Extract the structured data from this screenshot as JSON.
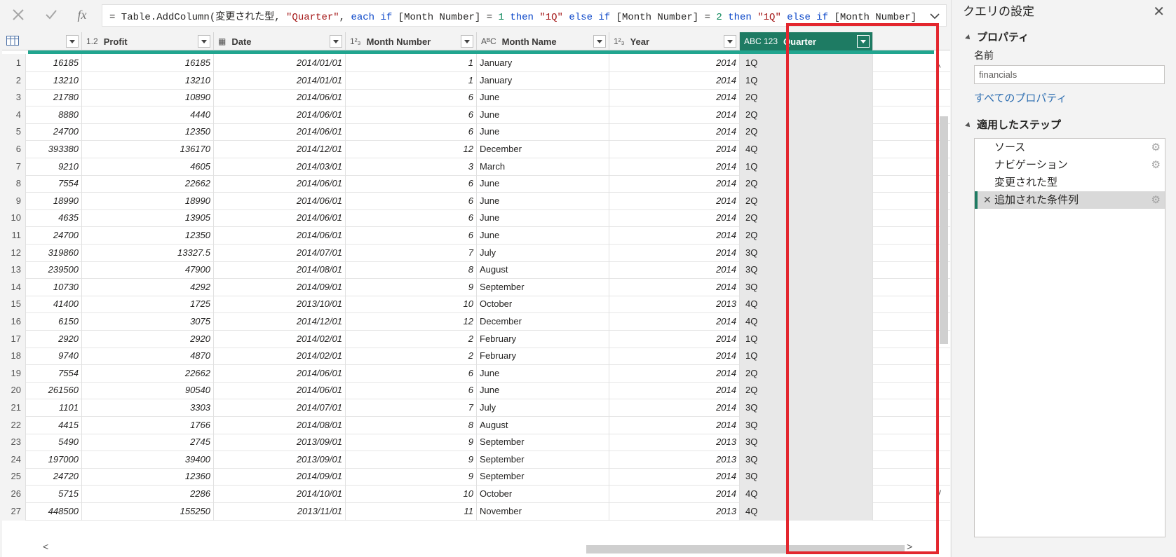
{
  "formula_bar": {
    "cancel_icon": "close-icon",
    "commit_icon": "check-icon",
    "fx_label": "fx",
    "formula": {
      "p1": "= Table.AddColumn(変更された型, ",
      "p2": "\"Quarter\"",
      "p3": ", ",
      "p4": "each if",
      "p5": " [Month Number] = ",
      "p6": "1",
      "p7": " ",
      "p8": "then",
      "p9": " ",
      "p10": "\"1Q\"",
      "p11": " ",
      "p12": "else if",
      "p13": " [Month Number] = ",
      "p14": "2",
      "p15": " ",
      "p16": "then",
      "p17": " ",
      "p18": "\"1Q\"",
      "p19": " ",
      "p20": "else if",
      "p21": " [Month Number]"
    }
  },
  "grid": {
    "columns": [
      {
        "type": "",
        "name": ""
      },
      {
        "type": "1.2",
        "name": "Profit"
      },
      {
        "type": "▦",
        "name": "Date"
      },
      {
        "type": "1²₃",
        "name": "Month Number"
      },
      {
        "type": "AᴮC",
        "name": "Month Name"
      },
      {
        "type": "1²₃",
        "name": "Year"
      },
      {
        "type": "ABC 123",
        "name": "Quarter"
      }
    ],
    "rows": [
      [
        "1",
        "16185",
        "16185",
        "2014/01/01",
        "1",
        "January",
        "2014",
        "1Q"
      ],
      [
        "2",
        "13210",
        "13210",
        "2014/01/01",
        "1",
        "January",
        "2014",
        "1Q"
      ],
      [
        "3",
        "21780",
        "10890",
        "2014/06/01",
        "6",
        "June",
        "2014",
        "2Q"
      ],
      [
        "4",
        "8880",
        "4440",
        "2014/06/01",
        "6",
        "June",
        "2014",
        "2Q"
      ],
      [
        "5",
        "24700",
        "12350",
        "2014/06/01",
        "6",
        "June",
        "2014",
        "2Q"
      ],
      [
        "6",
        "393380",
        "136170",
        "2014/12/01",
        "12",
        "December",
        "2014",
        "4Q"
      ],
      [
        "7",
        "9210",
        "4605",
        "2014/03/01",
        "3",
        "March",
        "2014",
        "1Q"
      ],
      [
        "8",
        "7554",
        "22662",
        "2014/06/01",
        "6",
        "June",
        "2014",
        "2Q"
      ],
      [
        "9",
        "18990",
        "18990",
        "2014/06/01",
        "6",
        "June",
        "2014",
        "2Q"
      ],
      [
        "10",
        "4635",
        "13905",
        "2014/06/01",
        "6",
        "June",
        "2014",
        "2Q"
      ],
      [
        "11",
        "24700",
        "12350",
        "2014/06/01",
        "6",
        "June",
        "2014",
        "2Q"
      ],
      [
        "12",
        "319860",
        "13327.5",
        "2014/07/01",
        "7",
        "July",
        "2014",
        "3Q"
      ],
      [
        "13",
        "239500",
        "47900",
        "2014/08/01",
        "8",
        "August",
        "2014",
        "3Q"
      ],
      [
        "14",
        "10730",
        "4292",
        "2014/09/01",
        "9",
        "September",
        "2014",
        "3Q"
      ],
      [
        "15",
        "41400",
        "1725",
        "2013/10/01",
        "10",
        "October",
        "2013",
        "4Q"
      ],
      [
        "16",
        "6150",
        "3075",
        "2014/12/01",
        "12",
        "December",
        "2014",
        "4Q"
      ],
      [
        "17",
        "2920",
        "2920",
        "2014/02/01",
        "2",
        "February",
        "2014",
        "1Q"
      ],
      [
        "18",
        "9740",
        "4870",
        "2014/02/01",
        "2",
        "February",
        "2014",
        "1Q"
      ],
      [
        "19",
        "7554",
        "22662",
        "2014/06/01",
        "6",
        "June",
        "2014",
        "2Q"
      ],
      [
        "20",
        "261560",
        "90540",
        "2014/06/01",
        "6",
        "June",
        "2014",
        "2Q"
      ],
      [
        "21",
        "1101",
        "3303",
        "2014/07/01",
        "7",
        "July",
        "2014",
        "3Q"
      ],
      [
        "22",
        "4415",
        "1766",
        "2014/08/01",
        "8",
        "August",
        "2014",
        "3Q"
      ],
      [
        "23",
        "5490",
        "2745",
        "2013/09/01",
        "9",
        "September",
        "2013",
        "3Q"
      ],
      [
        "24",
        "197000",
        "39400",
        "2013/09/01",
        "9",
        "September",
        "2013",
        "3Q"
      ],
      [
        "25",
        "24720",
        "12360",
        "2014/09/01",
        "9",
        "September",
        "2014",
        "3Q"
      ],
      [
        "26",
        "5715",
        "2286",
        "2014/10/01",
        "10",
        "October",
        "2014",
        "4Q"
      ],
      [
        "27",
        "448500",
        "155250",
        "2013/11/01",
        "11",
        "November",
        "2013",
        "4Q"
      ]
    ]
  },
  "query_settings": {
    "title": "クエリの設定",
    "properties_title": "プロパティ",
    "name_label": "名前",
    "name_value": "financials",
    "all_properties_link": "すべてのプロパティ",
    "applied_steps_title": "適用したステップ",
    "steps": [
      {
        "label": "ソース",
        "gear": true
      },
      {
        "label": "ナビゲーション",
        "gear": true
      },
      {
        "label": "変更された型",
        "gear": false
      },
      {
        "label": "追加された条件列",
        "gear": true,
        "active": true
      }
    ]
  },
  "colors": {
    "accent": "#1e7b63",
    "quality_bar": "#21a58f",
    "highlight": "#e3262e"
  }
}
